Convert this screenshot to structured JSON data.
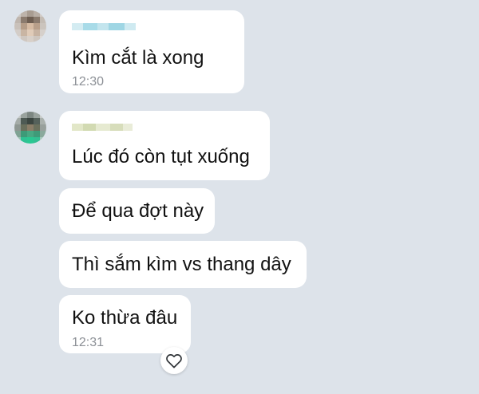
{
  "messages": [
    {
      "text": "Kìm cắt là xong",
      "time": "12:30"
    },
    {
      "text": "Lúc đó còn tụt xuống"
    },
    {
      "text": "Để qua đợt này"
    },
    {
      "text": "Thì sắm kìm vs thang dây"
    },
    {
      "text": "Ko thừa đâu",
      "time": "12:31"
    }
  ],
  "reaction": {
    "icon": "heart-icon"
  },
  "colors": {
    "background": "#dde3ea",
    "bubble": "#ffffff",
    "time": "#8c9096"
  }
}
